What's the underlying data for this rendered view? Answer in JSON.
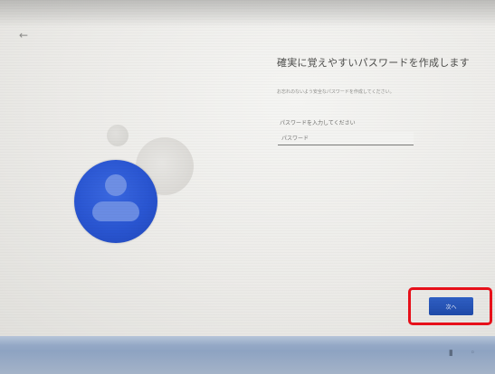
{
  "header": {
    "back_icon": "back-arrow-icon",
    "back_glyph": "←"
  },
  "main": {
    "title": "確実に覚えやすいパスワードを作成します",
    "subtitle": "お忘れのないよう安全なパスワードを作成してください。",
    "password_label": "パスワードを入力してください",
    "password_placeholder": "パスワード",
    "password_value": ""
  },
  "footer": {
    "next_label": "次へ",
    "highlight_color": "#e8101a",
    "button_color": "#1f4aa8"
  },
  "illustration": {
    "avatar_icon": "user-avatar-icon",
    "avatar_color": "#2955d1"
  },
  "taskbar": {
    "icons_text": "▮ ◦"
  }
}
